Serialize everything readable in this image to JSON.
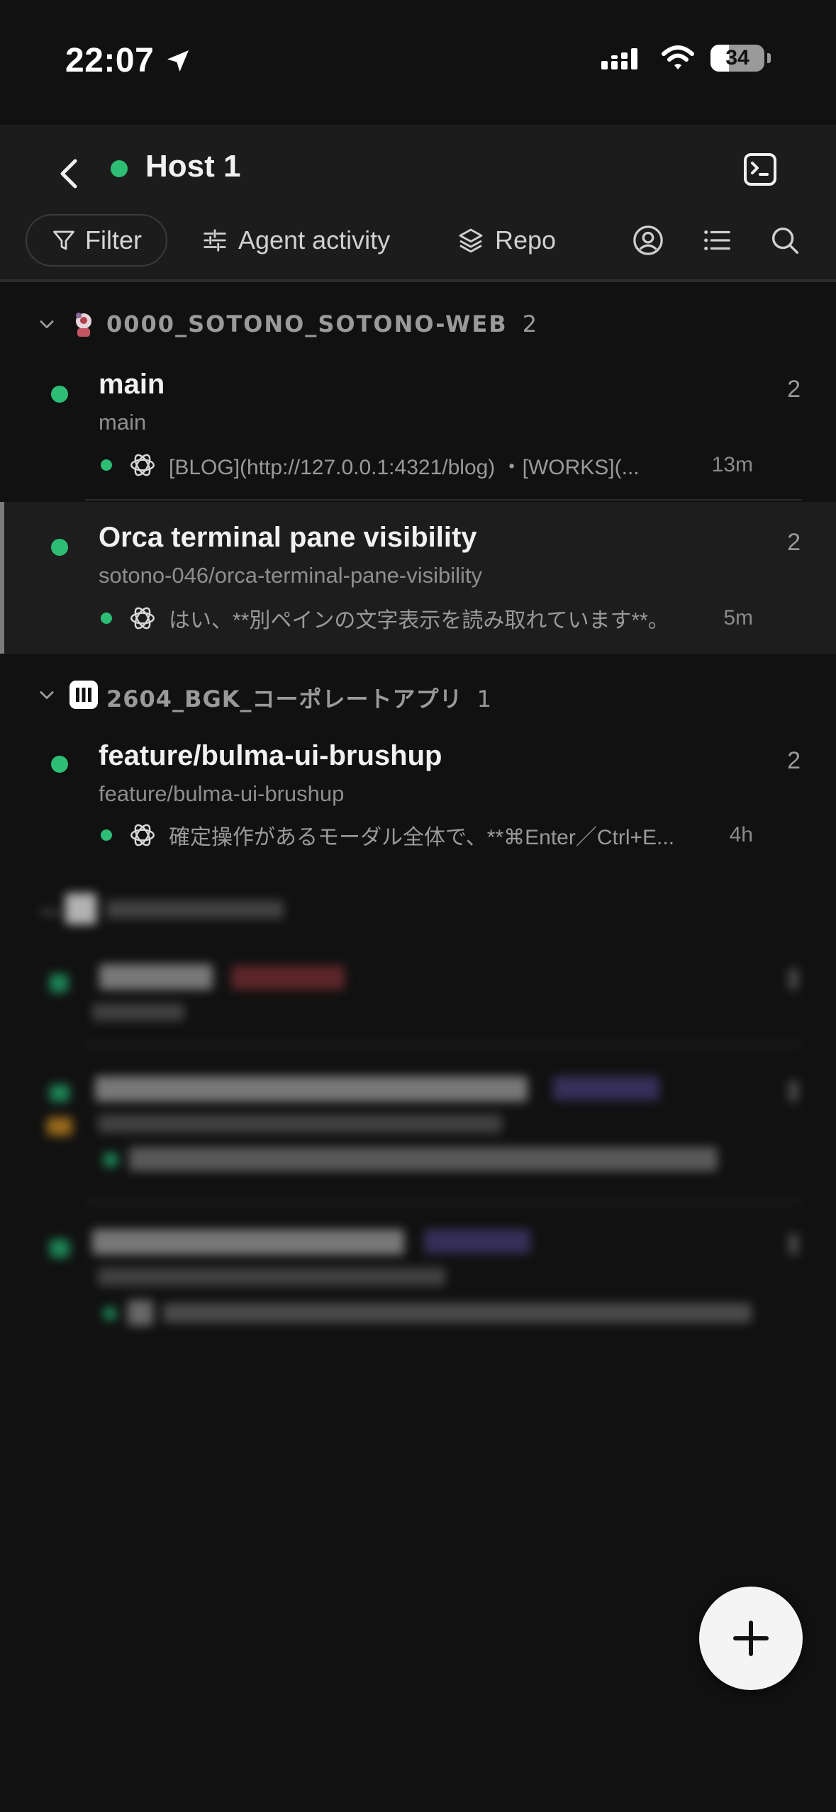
{
  "status_bar": {
    "time": "22:07",
    "battery": "34"
  },
  "header": {
    "host_title": "Host 1",
    "host_status_color": "#2ebd75"
  },
  "toolbar": {
    "filter_label": "Filter",
    "agent_activity_label": "Agent activity",
    "repo_label": "Repo"
  },
  "groups": [
    {
      "name": "0000_SOTONO_SOTONO-WEB",
      "count": "2",
      "rows": [
        {
          "title": "main",
          "branch": "main",
          "count": "2",
          "activity": "[BLOG](http://127.0.0.1:4321/blog) ・[WORKS](...",
          "time": "13m"
        },
        {
          "title": "Orca terminal pane visibility",
          "branch": "sotono-046/orca-terminal-pane-visibility",
          "count": "2",
          "activity": "はい、**別ペインの文字表示を読み取れています**。",
          "time": "5m"
        }
      ]
    },
    {
      "name": "2604_BGK_コーポレートアプリ",
      "count": "1",
      "rows": [
        {
          "title": "feature/bulma-ui-brushup",
          "branch": "feature/bulma-ui-brushup",
          "count": "2",
          "activity": "確定操作があるモーダル全体で、**⌘Enter／Ctrl+E...",
          "time": "4h"
        }
      ]
    }
  ]
}
